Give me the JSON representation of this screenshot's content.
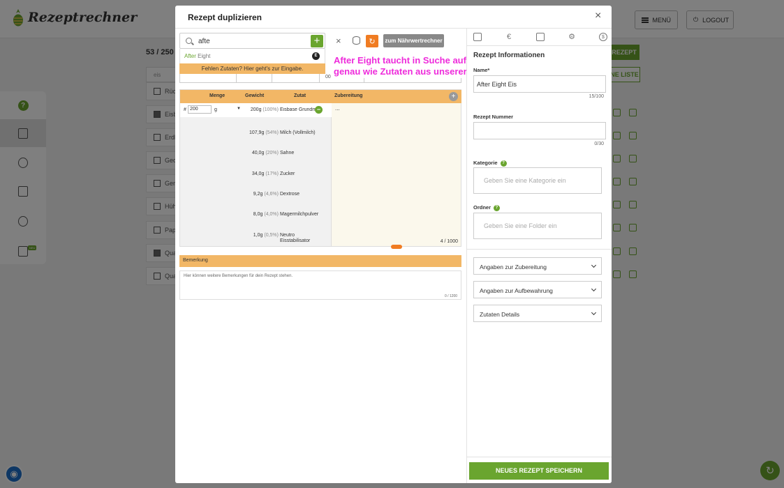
{
  "app": {
    "logo_text": "Rezeptrechner",
    "menu_label": "MENÜ",
    "logout_label": "LOGOUT",
    "recipe_counter": "53 / 250",
    "new_badge": "NEU",
    "bg_search_fragment": "eis",
    "new_recipe_fragment": "REZEPT",
    "new_list_fragment": "NE LISTE",
    "list_rows": [
      {
        "label": "Rüc",
        "checked": false
      },
      {
        "label": "Eisb",
        "checked": true
      },
      {
        "label": "Erdl",
        "checked": false
      },
      {
        "label": "Ged",
        "checked": false
      },
      {
        "label": "Gem",
        "checked": false
      },
      {
        "label": "Hüh",
        "checked": false
      },
      {
        "label": "Pap",
        "checked": false
      },
      {
        "label": "Qua",
        "checked": true
      },
      {
        "label": "Qua",
        "checked": false
      }
    ]
  },
  "modal": {
    "title": "Rezept duplizieren",
    "close_glyph": "×",
    "search": {
      "value": "afte",
      "add_glyph": "+",
      "suggestion_highlight": "After",
      "suggestion_rest": " Eight",
      "suggestion_badge": "E",
      "missing_text": "Fehlen Zutaten? Hier geht's zur Eingabe."
    },
    "toolbar": {
      "clear_glyph": "×",
      "refresh_glyph": "↻",
      "nutrition_label": "zum Nährwertrechner",
      "hidden_tab_fragment": "00"
    },
    "annotation": {
      "line1": "After Eight taucht in Suche auf",
      "line2": "genau wie Zutaten aus unserer DB"
    },
    "ingredients": {
      "headers": {
        "menge": "Menge",
        "gewicht": "Gewicht",
        "zutat": "Zutat"
      },
      "first_amount": "200",
      "first_hash": "#",
      "first_unit": "g",
      "first_caret": "▼",
      "remove_glyph": "−",
      "rows": [
        {
          "weight": "200g",
          "percent": "(100%)",
          "name": "Eisbase Grundmasse"
        },
        {
          "weight": "107,9g",
          "percent": "(54%)",
          "name": "Milch (Vollmilch)"
        },
        {
          "weight": "40,0g",
          "percent": "(20%)",
          "name": "Sahne"
        },
        {
          "weight": "34,0g",
          "percent": "(17%)",
          "name": "Zucker"
        },
        {
          "weight": "9,2g",
          "percent": "(4,6%)",
          "name": "Dextrose"
        },
        {
          "weight": "8,0g",
          "percent": "(4,0%)",
          "name": "Magermilchpulver"
        },
        {
          "weight": "1,0g",
          "percent": "(0,5%)",
          "name": "Neutro Eisstabilisator"
        }
      ]
    },
    "preparation": {
      "title": "Zubereitung",
      "add_glyph": "+",
      "content": "...",
      "count": "4 / 1000"
    },
    "remarks": {
      "title": "Bemerkung",
      "placeholder": "Hier können weitere Bemerkungen für dein Rezept stehen.",
      "count": "0 / 1200"
    },
    "info": {
      "tab_euro_glyph": "€",
      "tab_gear_glyph": "⚙",
      "tab_crossed_glyph": "$",
      "title": "Rezept Informationen",
      "name_label": "Name*",
      "name_value": "After Eight Eis",
      "name_count": "15/100",
      "number_label": "Rezept Nummer",
      "number_value": "",
      "number_count": "0/30",
      "category_label": "Kategorie",
      "category_placeholder": "Geben Sie eine Kategorie ein",
      "folder_label": "Ordner",
      "folder_placeholder": "Geben Sie eine Folder ein",
      "help_glyph": "?",
      "accordions": [
        "Angaben zur Zubereitung",
        "Angaben zur Aufbewahrung",
        "Zutaten Details"
      ],
      "save_label": "NEUES REZEPT SPEICHERN"
    }
  }
}
